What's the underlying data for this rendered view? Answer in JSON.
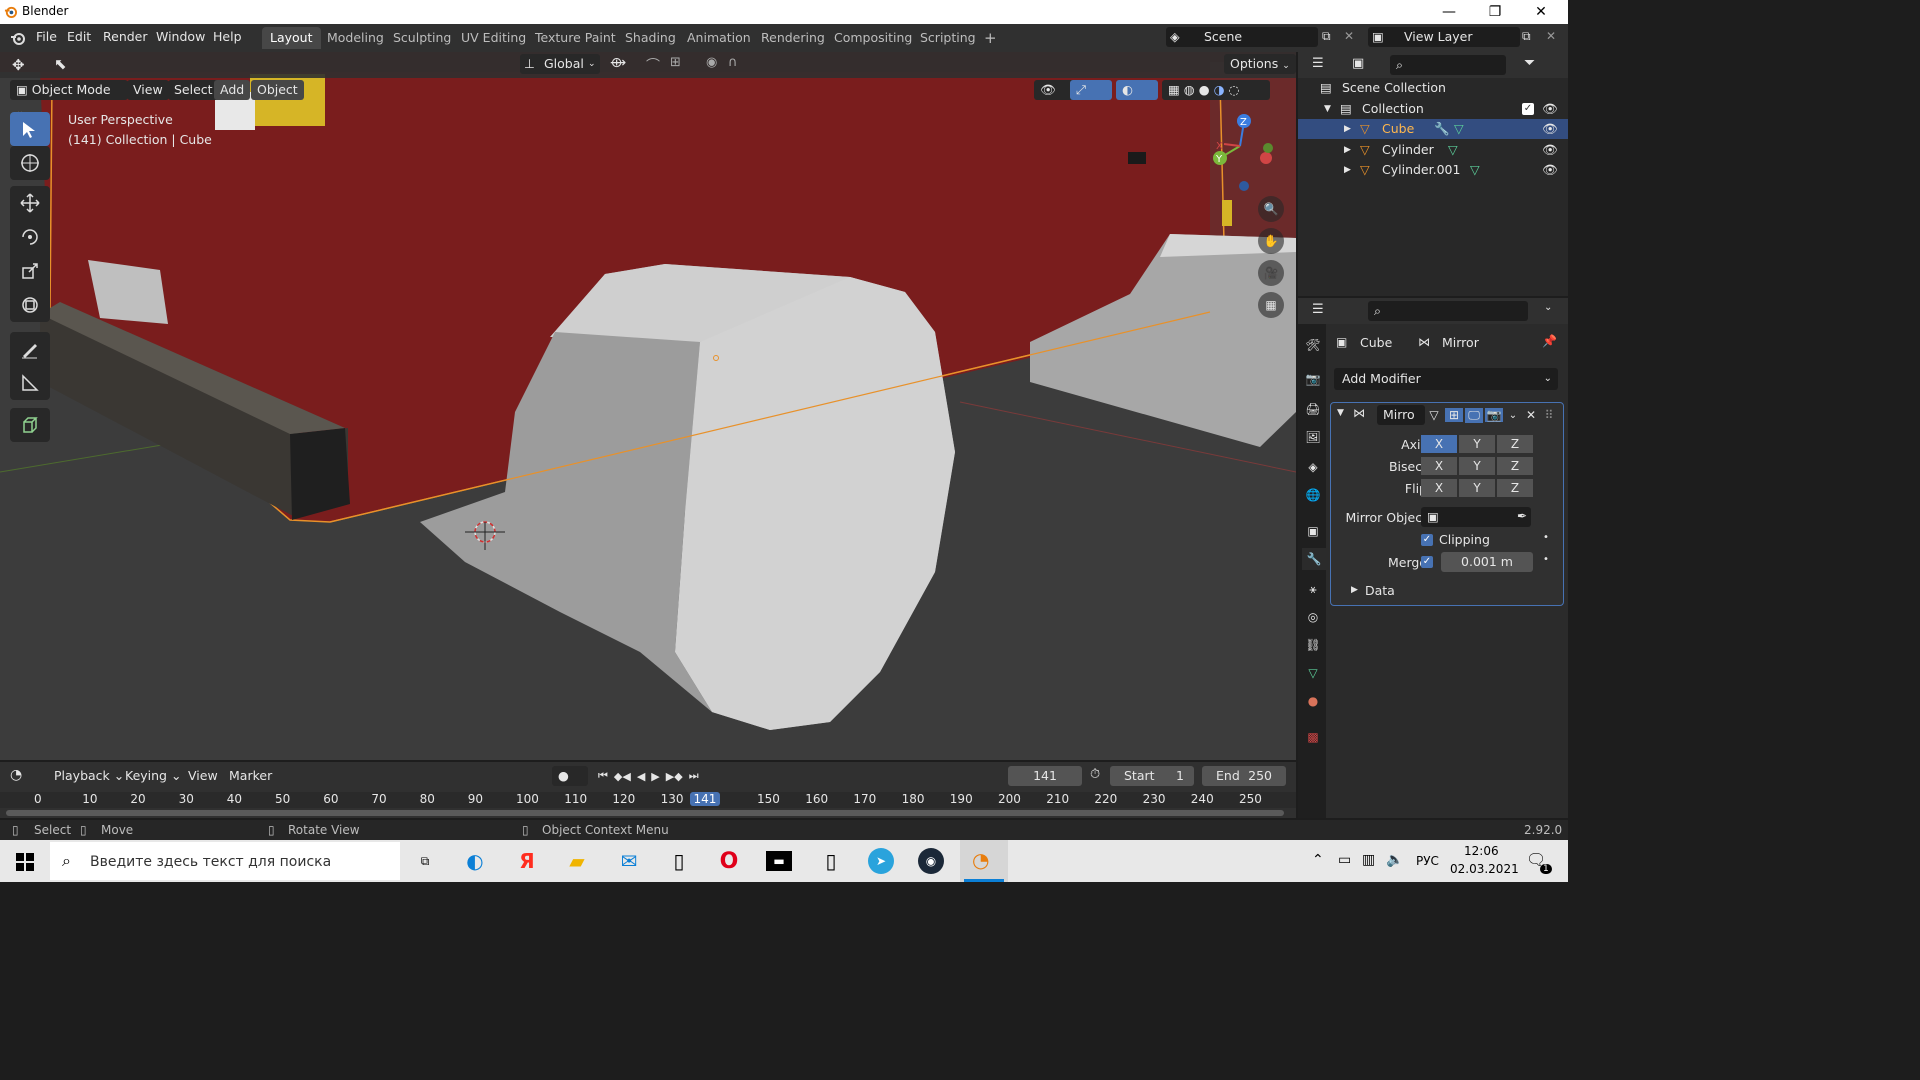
{
  "window": {
    "title": "Blender"
  },
  "menu": {
    "file": "File",
    "edit": "Edit",
    "render": "Render",
    "window": "Window",
    "help": "Help"
  },
  "workspaces": [
    "Layout",
    "Modeling",
    "Sculpting",
    "UV Editing",
    "Texture Paint",
    "Shading",
    "Animation",
    "Rendering",
    "Compositing",
    "Scripting"
  ],
  "top_right": {
    "scene": "Scene",
    "view_layer": "View Layer"
  },
  "viewport_header": {
    "transform": "Global",
    "options": "Options",
    "mode": "Object Mode",
    "view": "View",
    "select": "Select",
    "add": "Add",
    "object": "Object"
  },
  "viewport_overlay": {
    "perspective": "User Perspective",
    "context": "(141) Collection | Cube"
  },
  "gizmo": {
    "x": "X",
    "y": "Y",
    "z": "Z"
  },
  "outliner": {
    "scene_collection": "Scene Collection",
    "collection": "Collection",
    "items": [
      {
        "name": "Cube"
      },
      {
        "name": "Cylinder"
      },
      {
        "name": "Cylinder.001"
      }
    ]
  },
  "properties": {
    "breadcrumb_object": "Cube",
    "breadcrumb_modifier": "Mirror",
    "add_modifier": "Add Modifier",
    "modifier_name": "Mirro",
    "axis_label": "Axis",
    "bisect_label": "Bisect",
    "flip_label": "Flip",
    "axes": [
      "X",
      "Y",
      "Z"
    ],
    "mirror_object_label": "Mirror Object",
    "clipping_label": "Clipping",
    "merge_label": "Merge",
    "merge_value": "0.001 m",
    "data_label": "Data"
  },
  "timeline": {
    "playback": "Playback",
    "keying": "Keying",
    "view": "View",
    "marker": "Marker",
    "current_frame": "141",
    "start_label": "Start",
    "start": "1",
    "end_label": "End",
    "end": "250",
    "ticks": [
      "0",
      "10",
      "20",
      "30",
      "40",
      "50",
      "60",
      "70",
      "80",
      "90",
      "100",
      "110",
      "120",
      "130",
      "141",
      "150",
      "160",
      "170",
      "180",
      "190",
      "200",
      "210",
      "220",
      "230",
      "240",
      "250"
    ]
  },
  "statusbar": {
    "select": "Select",
    "move": "Move",
    "rotate": "Rotate View",
    "context": "Object Context Menu",
    "version": "2.92.0"
  },
  "taskbar": {
    "search_placeholder": "Введите здесь текст для поиска",
    "lang": "РУС",
    "time": "12:06",
    "date": "02.03.2021",
    "notif_count": "1"
  }
}
